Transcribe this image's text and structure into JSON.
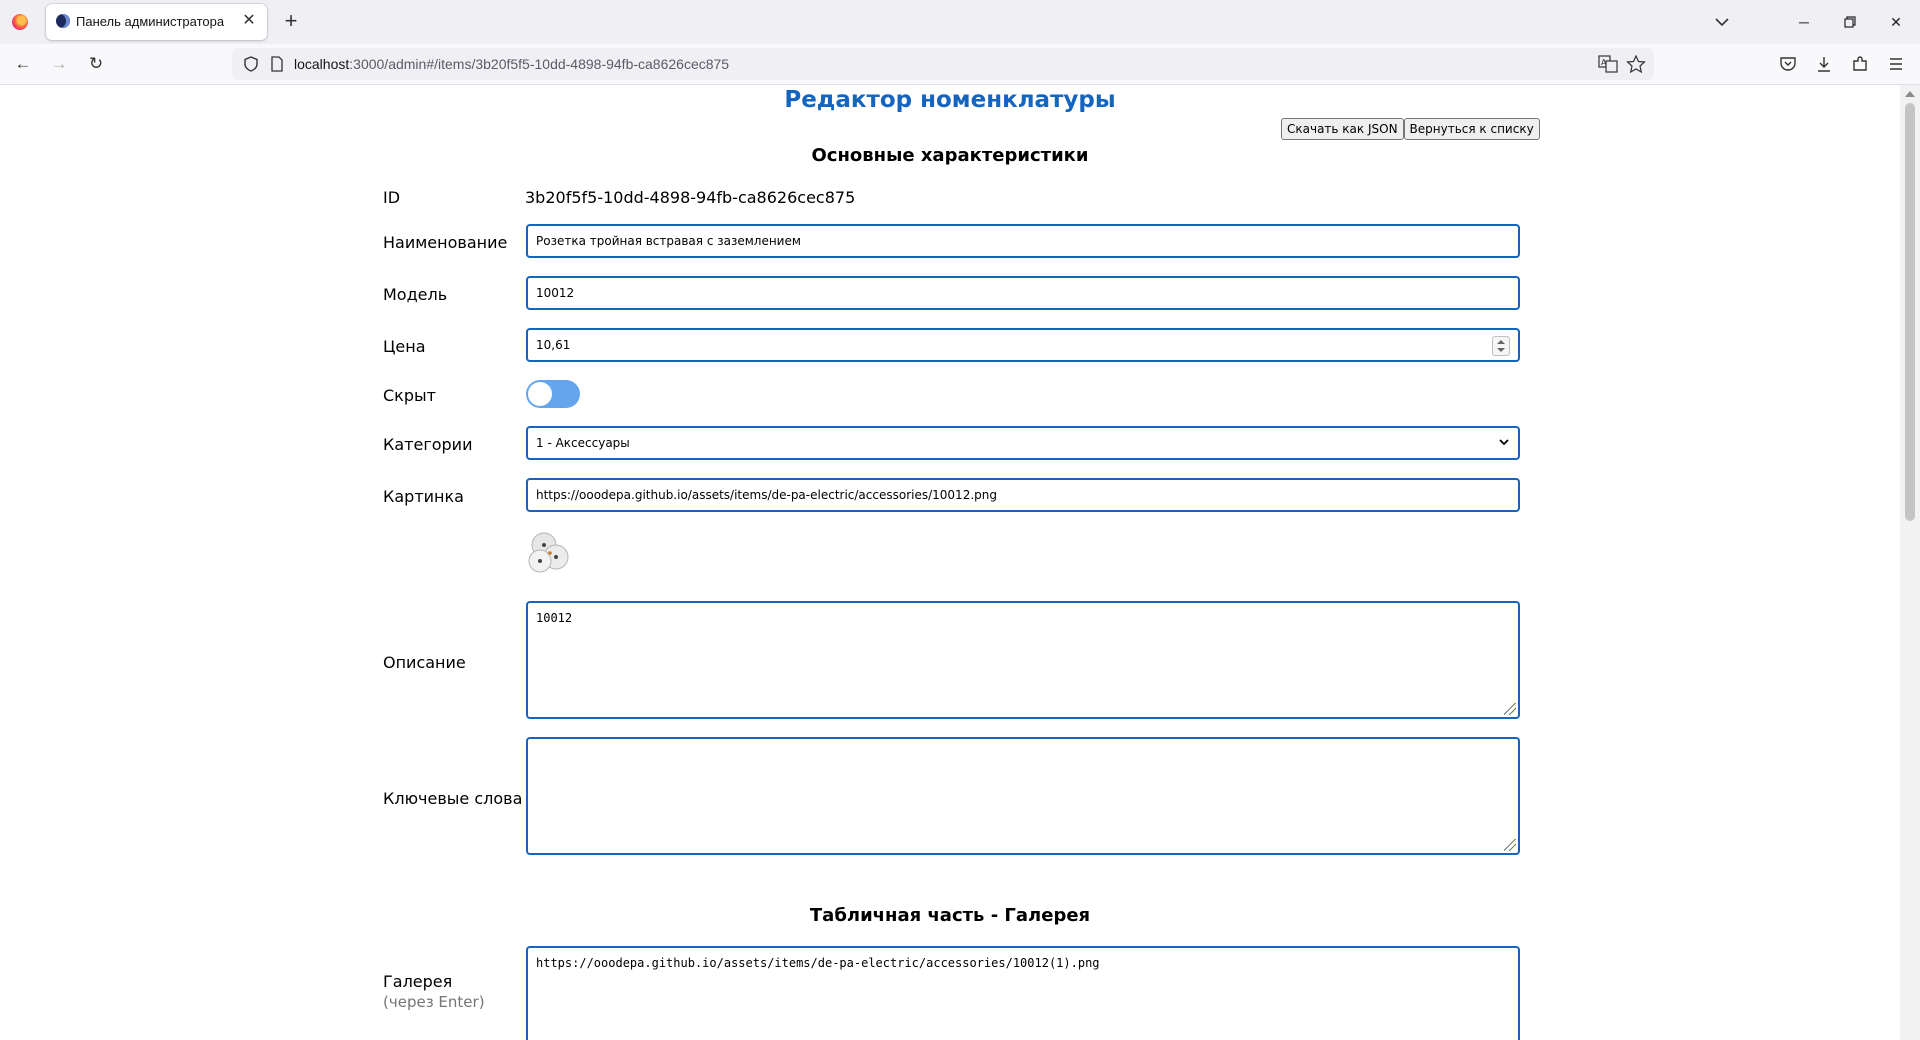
{
  "browser": {
    "tab_title": "Панель администратора",
    "url_host": "localhost",
    "url_path": ":3000/admin#/items/3b20f5f5-10dd-4898-94fb-ca8626cec875",
    "icons": [
      "firefox-logo",
      "close-icon",
      "plus-icon",
      "chevron-down-icon",
      "minimize-icon",
      "restore-icon",
      "back-arrow-icon",
      "forward-arrow-icon",
      "reload-icon",
      "shield-icon",
      "page-icon",
      "translate-icon",
      "star-icon",
      "pocket-icon",
      "download-icon",
      "extensions-icon",
      "menu-icon"
    ]
  },
  "page": {
    "title": "Редактор номенклатуры",
    "buttons": {
      "download_json": "Скачать как JSON",
      "back_to_list": "Вернуться к списку"
    },
    "sections": {
      "main": "Основные характеристики",
      "gallery": "Табличная часть - Галерея"
    }
  },
  "form": {
    "id": {
      "label": "ID",
      "value": "3b20f5f5-10dd-4898-94fb-ca8626cec875"
    },
    "name": {
      "label": "Наименование",
      "value": "Розетка тройная встравая с заземлением"
    },
    "model": {
      "label": "Модель",
      "value": "10012"
    },
    "price": {
      "label": "Цена",
      "value": "10,61"
    },
    "hidden": {
      "label": "Скрыт",
      "checked": false
    },
    "categories": {
      "label": "Категории",
      "value": "1 - Аксессуары"
    },
    "picture": {
      "label": "Картинка",
      "value": "https://ooodepa.github.io/assets/items/de-pa-electric/accessories/10012.png"
    },
    "description": {
      "label": "Описание",
      "value": "10012"
    },
    "keywords": {
      "label": "Ключевые слова",
      "value": ""
    },
    "gallery": {
      "label": "Галерея",
      "hint": "(через Enter)",
      "value": "https://ooodepa.github.io/assets/items/de-pa-electric/accessories/10012(1).png"
    }
  },
  "colors": {
    "accent": "#1565c0",
    "toggle": "#64a6ee",
    "field_border": "#1565c0"
  }
}
